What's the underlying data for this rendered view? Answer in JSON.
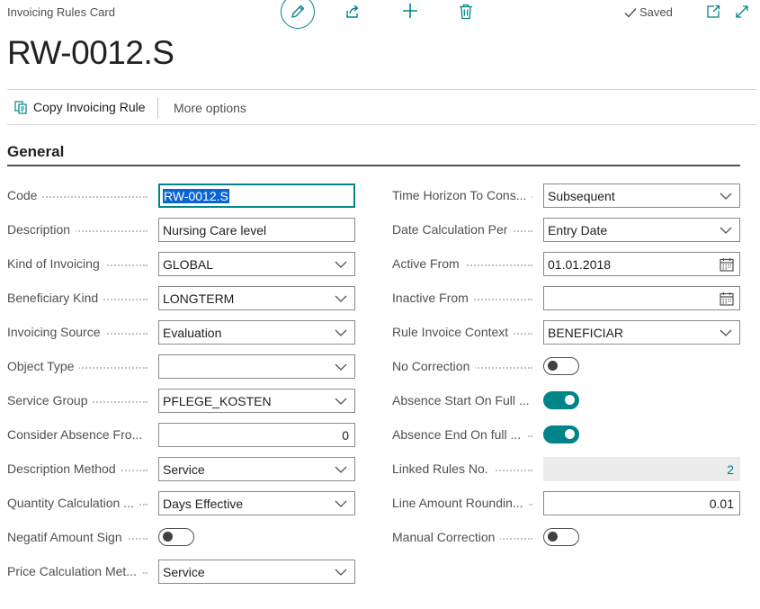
{
  "header": {
    "caption": "Invoicing Rules Card",
    "status": "Saved",
    "title": "RW-0012.S"
  },
  "actions": {
    "copy_label": "Copy Invoicing Rule",
    "more_label": "More options"
  },
  "section": {
    "title": "General"
  },
  "colors": {
    "accent": "#008489",
    "selection": "#0a64d2",
    "readonly_bg": "#ececec"
  },
  "icons": [
    "edit-icon",
    "share-icon",
    "add-icon",
    "delete-icon",
    "checkmark-icon",
    "popout-icon",
    "expand-icon",
    "copy-icon",
    "chevron-down-icon",
    "calendar-icon"
  ],
  "fields_left": [
    {
      "label": "Code",
      "type": "text",
      "value": "RW-0012.S",
      "selected": true
    },
    {
      "label": "Description",
      "type": "text",
      "value": "Nursing Care level"
    },
    {
      "label": "Kind of Invoicing",
      "type": "select",
      "value": "GLOBAL"
    },
    {
      "label": "Beneficiary Kind",
      "type": "select",
      "value": "LONGTERM"
    },
    {
      "label": "Invoicing Source",
      "type": "select",
      "value": "Evaluation"
    },
    {
      "label": "Object Type",
      "type": "select",
      "value": ""
    },
    {
      "label": "Service Group",
      "type": "select",
      "value": "PFLEGE_KOSTEN"
    },
    {
      "label": "Consider Absence Fro...",
      "type": "number",
      "value": "0"
    },
    {
      "label": "Description Method",
      "type": "select",
      "value": "Service"
    },
    {
      "label": "Quantity Calculation ...",
      "type": "select",
      "value": "Days Effective"
    },
    {
      "label": "Negatif Amount Sign",
      "type": "toggle",
      "value": "off"
    },
    {
      "label": "Price Calculation Met...",
      "type": "select",
      "value": "Service"
    }
  ],
  "fields_right": [
    {
      "label": "Time Horizon To Cons...",
      "type": "select",
      "value": "Subsequent"
    },
    {
      "label": "Date Calculation Per",
      "type": "select",
      "value": "Entry Date"
    },
    {
      "label": "Active From",
      "type": "date",
      "value": "01.01.2018"
    },
    {
      "label": "Inactive From",
      "type": "date",
      "value": ""
    },
    {
      "label": "Rule Invoice Context",
      "type": "select",
      "value": "BENEFICIAR"
    },
    {
      "label": "No Correction",
      "type": "toggle",
      "value": "off"
    },
    {
      "label": "Absence Start On Full ...",
      "type": "toggle",
      "value": "on"
    },
    {
      "label": "Absence End On full ...",
      "type": "toggle",
      "value": "on"
    },
    {
      "label": "Linked Rules No.",
      "type": "readonly",
      "value": "2"
    },
    {
      "label": "Line Amount Roundin...",
      "type": "number",
      "value": "0.01"
    },
    {
      "label": "Manual Correction",
      "type": "toggle",
      "value": "off"
    }
  ]
}
